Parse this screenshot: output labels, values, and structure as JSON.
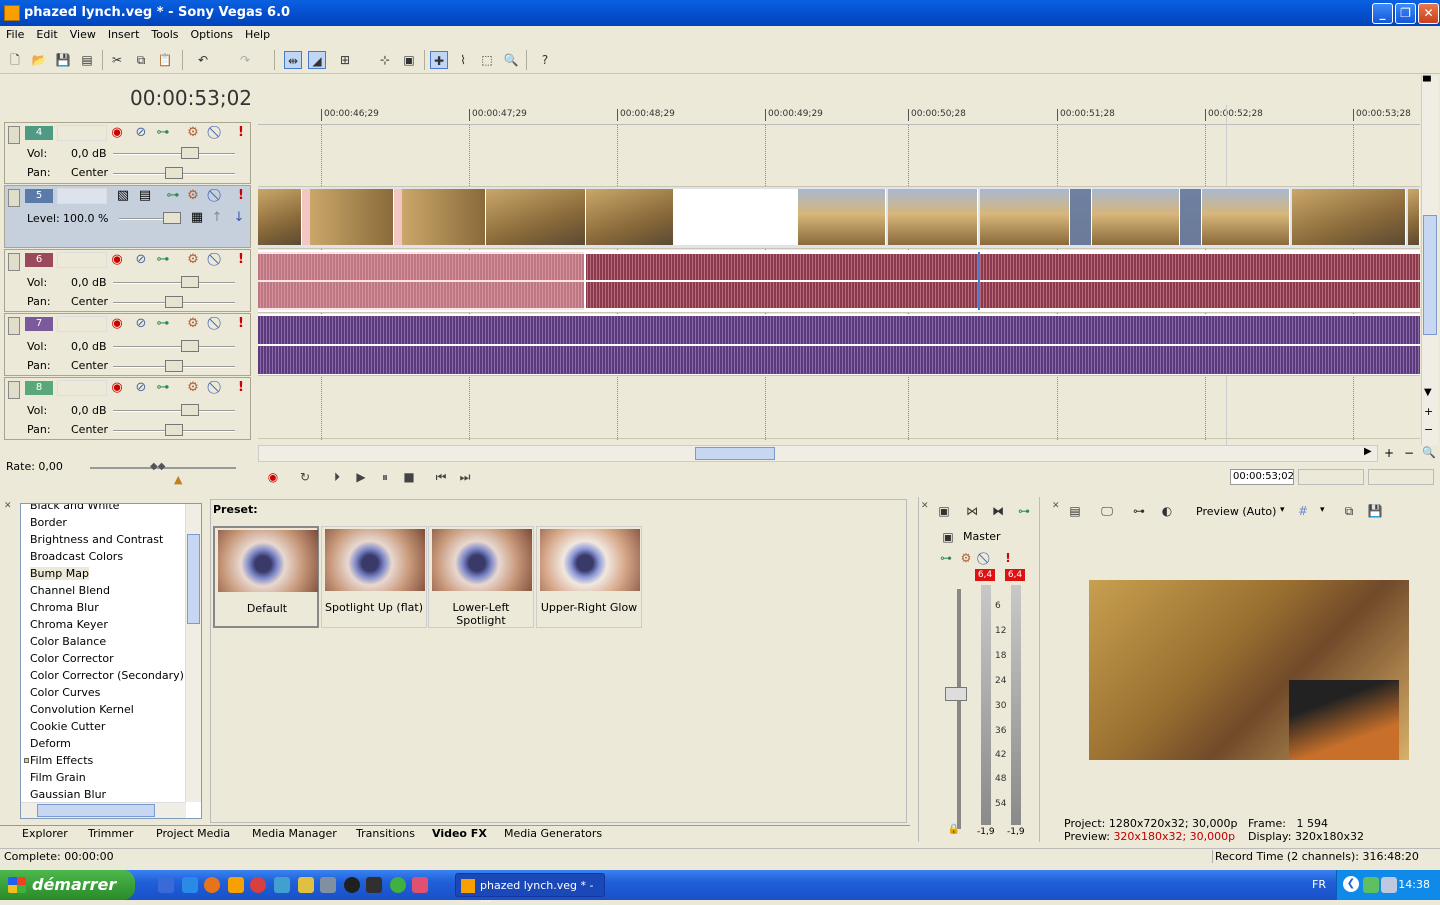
{
  "window": {
    "title": "phazed lynch.veg * - Sony Vegas 6.0"
  },
  "menu": [
    "File",
    "Edit",
    "View",
    "Insert",
    "Tools",
    "Options",
    "Help"
  ],
  "timeline": {
    "cursor_time": "00:00:53;02",
    "ruler_ticks": [
      "00:00:46;29",
      "00:00:47;29",
      "00:00:48;29",
      "00:00:49;29",
      "00:00:50;28",
      "00:00:51;28",
      "00:00:52;28",
      "00:00:53;28"
    ]
  },
  "tracks": [
    {
      "number": "4",
      "type": "audio",
      "vol_label": "Vol:",
      "vol": "0,0 dB",
      "pan_label": "Pan:",
      "pan": "Center"
    },
    {
      "number": "5",
      "type": "video",
      "level_label": "Level:",
      "level": "100.0 %"
    },
    {
      "number": "6",
      "type": "audio",
      "vol_label": "Vol:",
      "vol": "0,0 dB",
      "pan_label": "Pan:",
      "pan": "Center"
    },
    {
      "number": "7",
      "type": "audio",
      "vol_label": "Vol:",
      "vol": "0,0 dB",
      "pan_label": "Pan:",
      "pan": "Center"
    },
    {
      "number": "8",
      "type": "audio",
      "vol_label": "Vol:",
      "vol": "0,0 dB",
      "pan_label": "Pan:",
      "pan": "Center"
    }
  ],
  "rate": {
    "label": "Rate: 0,00"
  },
  "transport": {
    "timecode": "00:00:53;02"
  },
  "video_fx": {
    "items": [
      "Black and White",
      "Border",
      "Brightness and Contrast",
      "Broadcast Colors",
      "Bump Map",
      "Channel Blend",
      "Chroma Blur",
      "Chroma Keyer",
      "Color Balance",
      "Color Corrector",
      "Color Corrector (Secondary)",
      "Color Curves",
      "Convolution Kernel",
      "Cookie Cutter",
      "Deform",
      "Film Effects",
      "Film Grain",
      "Gaussian Blur"
    ],
    "selected": "Bump Map",
    "preset_label": "Preset:",
    "presets": [
      "Default",
      "Spotlight Up (flat)",
      "Lower-Left Spotlight",
      "Upper-Right Glow"
    ]
  },
  "tabs": [
    "Explorer",
    "Trimmer",
    "Project Media",
    "Media Manager",
    "Transitions",
    "Video FX",
    "Media Generators"
  ],
  "active_tab": "Video FX",
  "mixer": {
    "master_label": "Master",
    "peak_left": "6,4",
    "peak_right": "6,4",
    "scale": [
      "6",
      "12",
      "18",
      "24",
      "30",
      "36",
      "42",
      "48",
      "54"
    ],
    "bottom_left": "-1,9",
    "bottom_right": "-1,9"
  },
  "preview": {
    "mode": "Preview (Auto)",
    "project_label": "Project:",
    "project_value": "1280x720x32; 30,000p",
    "preview_label": "Preview:",
    "preview_value": "320x180x32; 30,000p",
    "frame_label": "Frame:",
    "frame_value": "1 594",
    "display_label": "Display:",
    "display_value": "320x180x32"
  },
  "status": {
    "left": "Complete: 00:00:00",
    "right": "Record Time (2 channels): 316:48:20"
  },
  "taskbar": {
    "start": "démarrer",
    "task": "phazed lynch.veg * - ...",
    "lang": "FR",
    "clock": "14:38"
  },
  "colors": {
    "titlebar": "#0550d0",
    "audio_wave": "#8a3a4a",
    "purple_wave": "#5a3a7a",
    "peak": "#e01010"
  }
}
